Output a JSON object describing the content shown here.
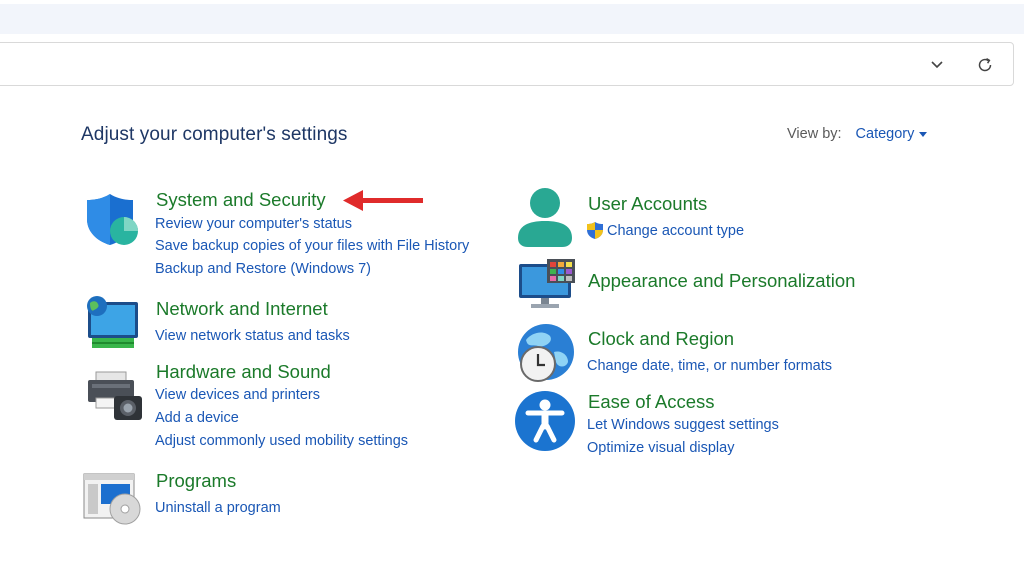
{
  "heading": "Adjust your computer's settings",
  "view_by": {
    "label": "View by:",
    "value": "Category"
  },
  "colors": {
    "title": "#1b7a2a",
    "link": "#1a57b5",
    "heading": "#1e3765",
    "arrow": "#e02b2b"
  },
  "categories": {
    "system_security": {
      "title": "System and Security",
      "icon": "shield-icon",
      "links": [
        "Review your computer's status",
        "Save backup copies of your files with File History",
        "Backup and Restore (Windows 7)"
      ]
    },
    "network_internet": {
      "title": "Network and Internet",
      "icon": "network-globe-icon",
      "links": [
        "View network status and tasks"
      ]
    },
    "hardware_sound": {
      "title": "Hardware and Sound",
      "icon": "printer-camera-icon",
      "links": [
        "View devices and printers",
        "Add a device",
        "Adjust commonly used mobility settings"
      ]
    },
    "programs": {
      "title": "Programs",
      "icon": "programs-disc-icon",
      "links": [
        "Uninstall a program"
      ]
    },
    "user_accounts": {
      "title": "User Accounts",
      "icon": "user-icon",
      "links": [
        "Change account type"
      ]
    },
    "appearance": {
      "title": "Appearance and Personalization",
      "icon": "monitor-palette-icon",
      "links": []
    },
    "clock_region": {
      "title": "Clock and Region",
      "icon": "globe-clock-icon",
      "links": [
        "Change date, time, or number formats"
      ]
    },
    "ease_access": {
      "title": "Ease of Access",
      "icon": "accessibility-icon",
      "links": [
        "Let Windows suggest settings",
        "Optimize visual display"
      ]
    }
  }
}
